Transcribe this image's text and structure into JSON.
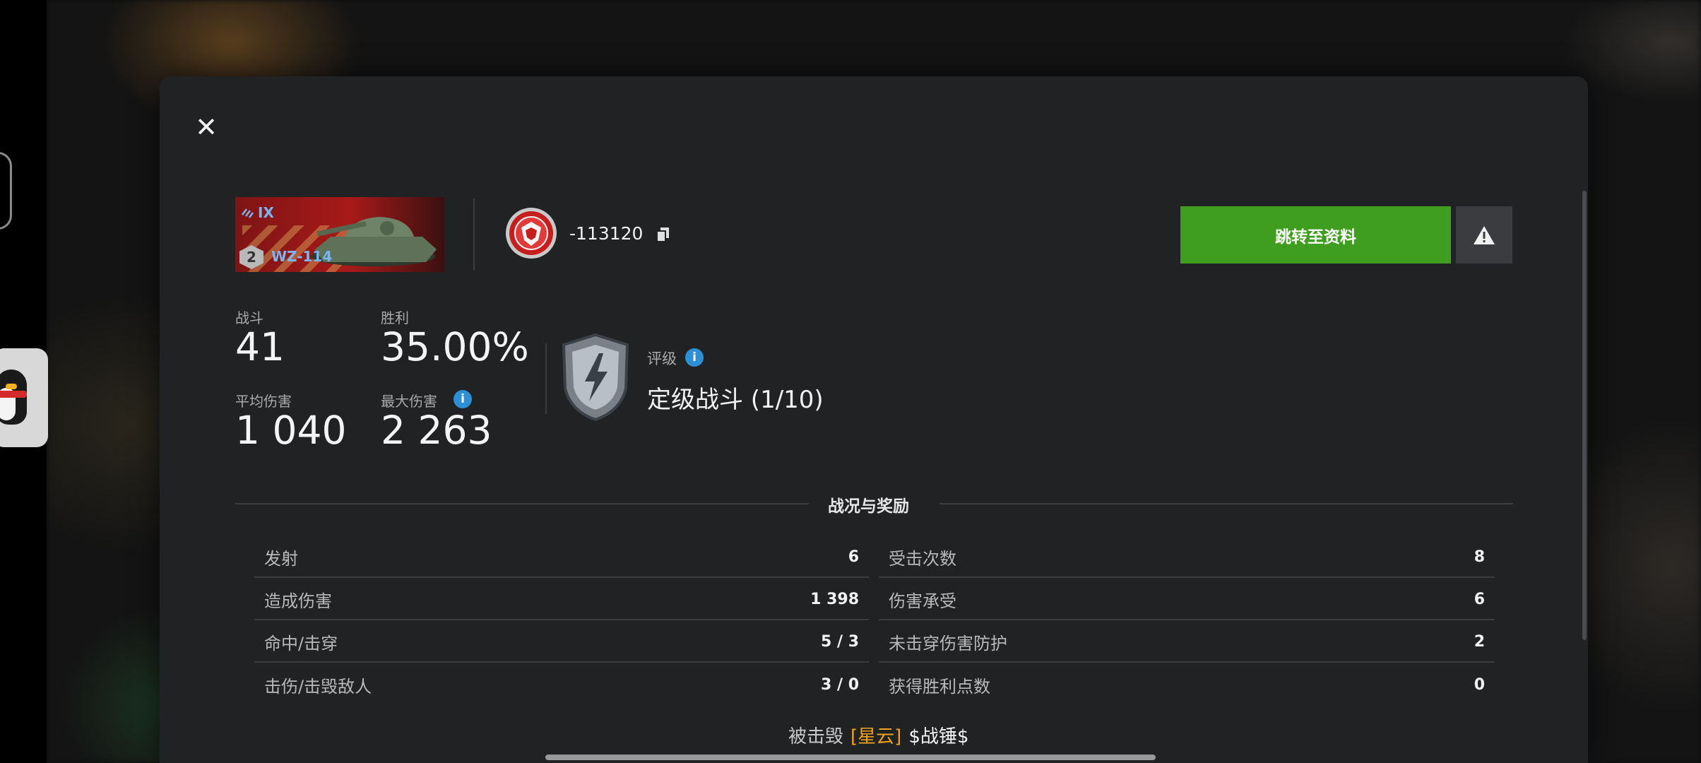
{
  "dialog": {
    "close_icon": "close-icon",
    "tank": {
      "tier": "IX",
      "mastery_level": "2",
      "name": "WZ-114"
    },
    "player": {
      "id": "-113120",
      "copy_icon": "copy-icon",
      "clan_emblem": "clan-emblem-icon"
    },
    "buttons": {
      "profile_label": "跳转至资料",
      "report_icon": "warning-icon"
    },
    "stats": {
      "battles": {
        "label": "战斗",
        "value": "41"
      },
      "winrate": {
        "label": "胜利",
        "value": "35.00%"
      },
      "avg_damage": {
        "label": "平均伤害",
        "value": "1 040"
      },
      "max_damage": {
        "label": "最大伤害",
        "value": "2 263"
      }
    },
    "rating": {
      "label": "评级",
      "value": "定级战斗 (1/10)"
    },
    "section_title": "战况与奖励",
    "left_rows": [
      {
        "label": "发射",
        "value": "6"
      },
      {
        "label": "造成伤害",
        "value": "1 398"
      },
      {
        "label": "命中/击穿",
        "value": "5 / 3"
      },
      {
        "label": "击伤/击毁敌人",
        "value": "3 / 0"
      }
    ],
    "right_rows": [
      {
        "label": "受击次数",
        "value": "8"
      },
      {
        "label": "伤害承受",
        "value": "6"
      },
      {
        "label": "未击穿伤害防护",
        "value": "2"
      },
      {
        "label": "获得胜利点数",
        "value": "0"
      }
    ],
    "killed_by": {
      "label": "被击毁",
      "clan": "[星云]",
      "name": "$战锤$"
    }
  },
  "colors": {
    "accent_green": "#3f9e1f",
    "info_blue": "#2d8fd6",
    "clan_orange": "#f0a21c",
    "tank_blue": "#79b6f0"
  }
}
